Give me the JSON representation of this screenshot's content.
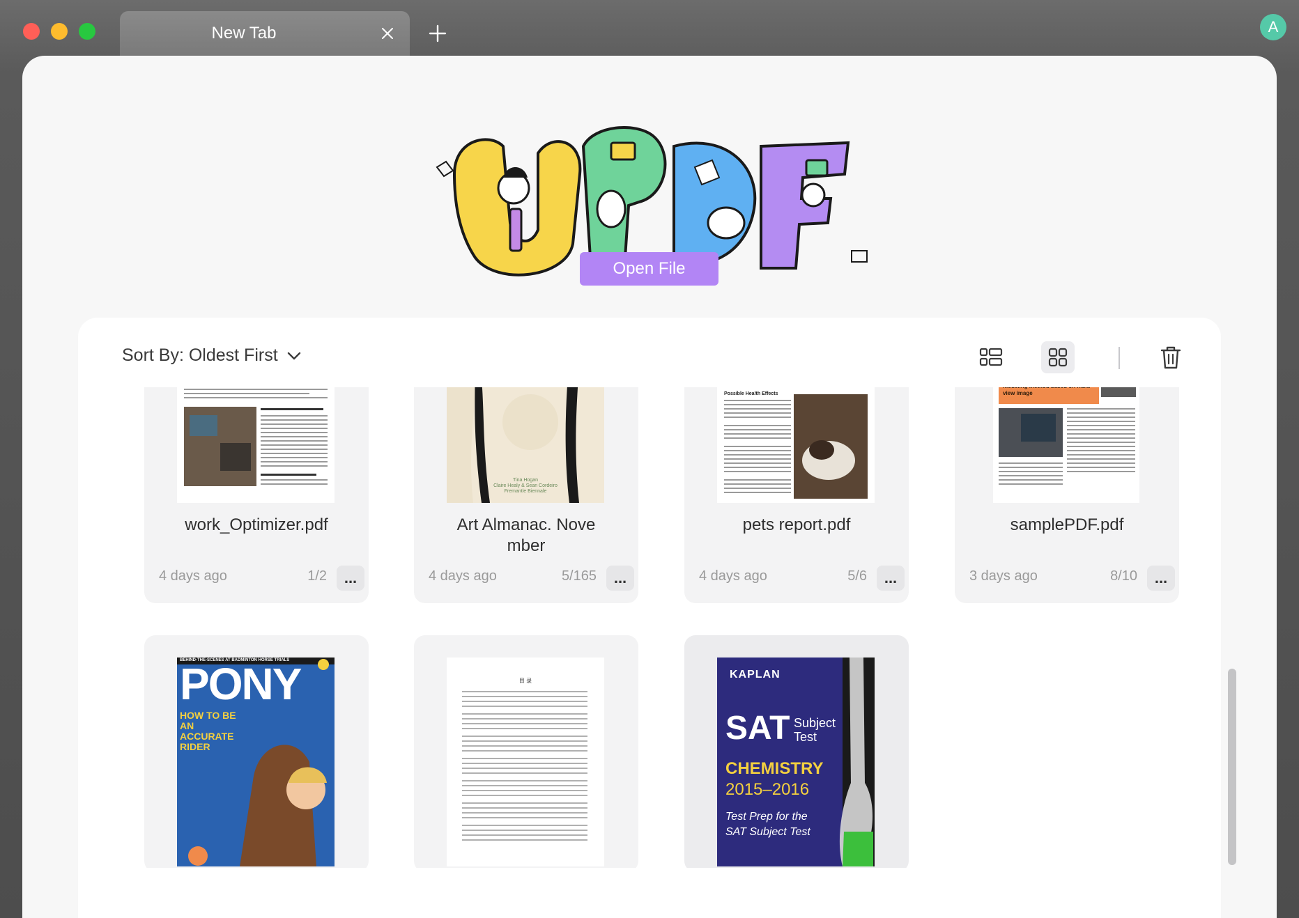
{
  "titlebar": {
    "tab_title": "New Tab",
    "avatar_letter": "A"
  },
  "main": {
    "logo_text": "UPDF",
    "open_file_label": "Open File"
  },
  "toolbar": {
    "sort_label": "Sort By: Oldest First"
  },
  "files": [
    {
      "name": "work_Optimizer.pdf",
      "date": "4 days ago",
      "pages": "1/2"
    },
    {
      "name": "Art Almanac. November",
      "date": "4 days ago",
      "pages": "5/165",
      "thumb_text": "Tina Hogan\nClaire Healy & Sean Cordeiro\nFremantle Biennale"
    },
    {
      "name": "pets report.pdf",
      "date": "4 days ago",
      "pages": "5/6",
      "thumb_heading": "Possible Health Effects"
    },
    {
      "name": "samplePDF.pdf",
      "date": "3 days ago",
      "pages": "8/10",
      "thumb_heading": "Building environment information modeling method based on multi-view image"
    },
    {
      "name": "",
      "thumb_heading": "PONY",
      "thumb_top": "BEHIND-THE-SCENES AT BADMINTON HORSE TRIALS",
      "thumb_sub": "HOW TO BE AN ACCURATE RIDER"
    },
    {
      "name": "",
      "thumb_heading": "目 录"
    },
    {
      "name": "",
      "thumb_heading": "SAT",
      "thumb_top": "KAPLAN",
      "thumb_sub": "Subject Test",
      "thumb_line1": "CHEMISTRY",
      "thumb_line2": "2015–2016",
      "thumb_line3": "Test Prep for the",
      "thumb_line4": "SAT Subject Test"
    }
  ],
  "more_label": "...",
  "colors": {
    "accent": "#b285f5",
    "avatar": "#55c9a8"
  }
}
